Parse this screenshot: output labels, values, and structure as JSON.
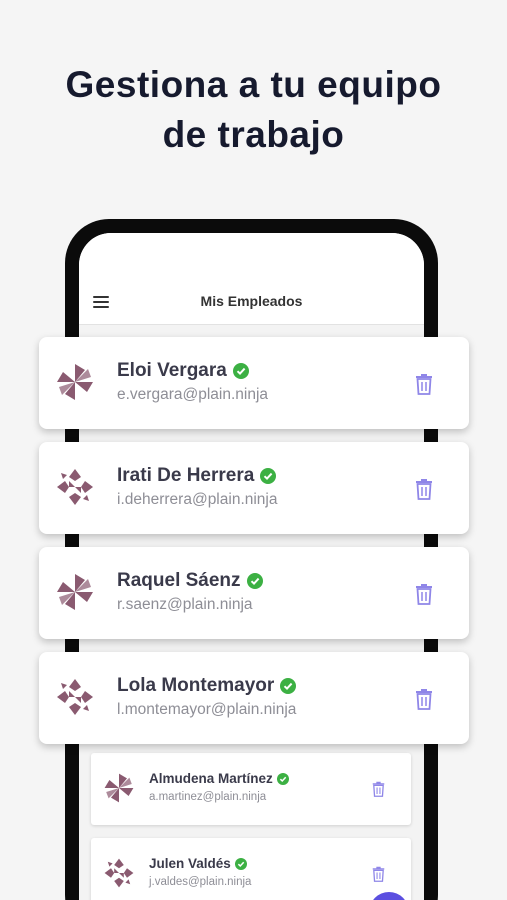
{
  "headline": {
    "line1": "Gestiona a tu equipo",
    "line2": "de trabajo"
  },
  "appbar": {
    "title": "Mis Empleados"
  },
  "colors": {
    "verified": "#3cb043",
    "trash": "#8f86e8",
    "avatar": "#8a5a70",
    "fab": "#5b4fe0"
  },
  "employees": [
    {
      "name": "Eloi Vergara",
      "email": "e.vergara@plain.ninja",
      "verified": true,
      "avatar_icon": "pinwheel-icon"
    },
    {
      "name": "Irati De Herrera",
      "email": "i.deherrera@plain.ninja",
      "verified": true,
      "avatar_icon": "geometric-pattern-icon"
    },
    {
      "name": "Raquel Sáenz",
      "email": "r.saenz@plain.ninja",
      "verified": true,
      "avatar_icon": "pinwheel-icon"
    },
    {
      "name": "Lola Montemayor",
      "email": "l.montemayor@plain.ninja",
      "verified": true,
      "avatar_icon": "geometric-pattern-icon"
    },
    {
      "name": "Almudena Martínez",
      "email": "a.martinez@plain.ninja",
      "verified": true,
      "avatar_icon": "pinwheel-icon"
    },
    {
      "name": "Julen Valdés",
      "email": "j.valdes@plain.ninja",
      "verified": true,
      "avatar_icon": "geometric-pattern-icon"
    }
  ]
}
